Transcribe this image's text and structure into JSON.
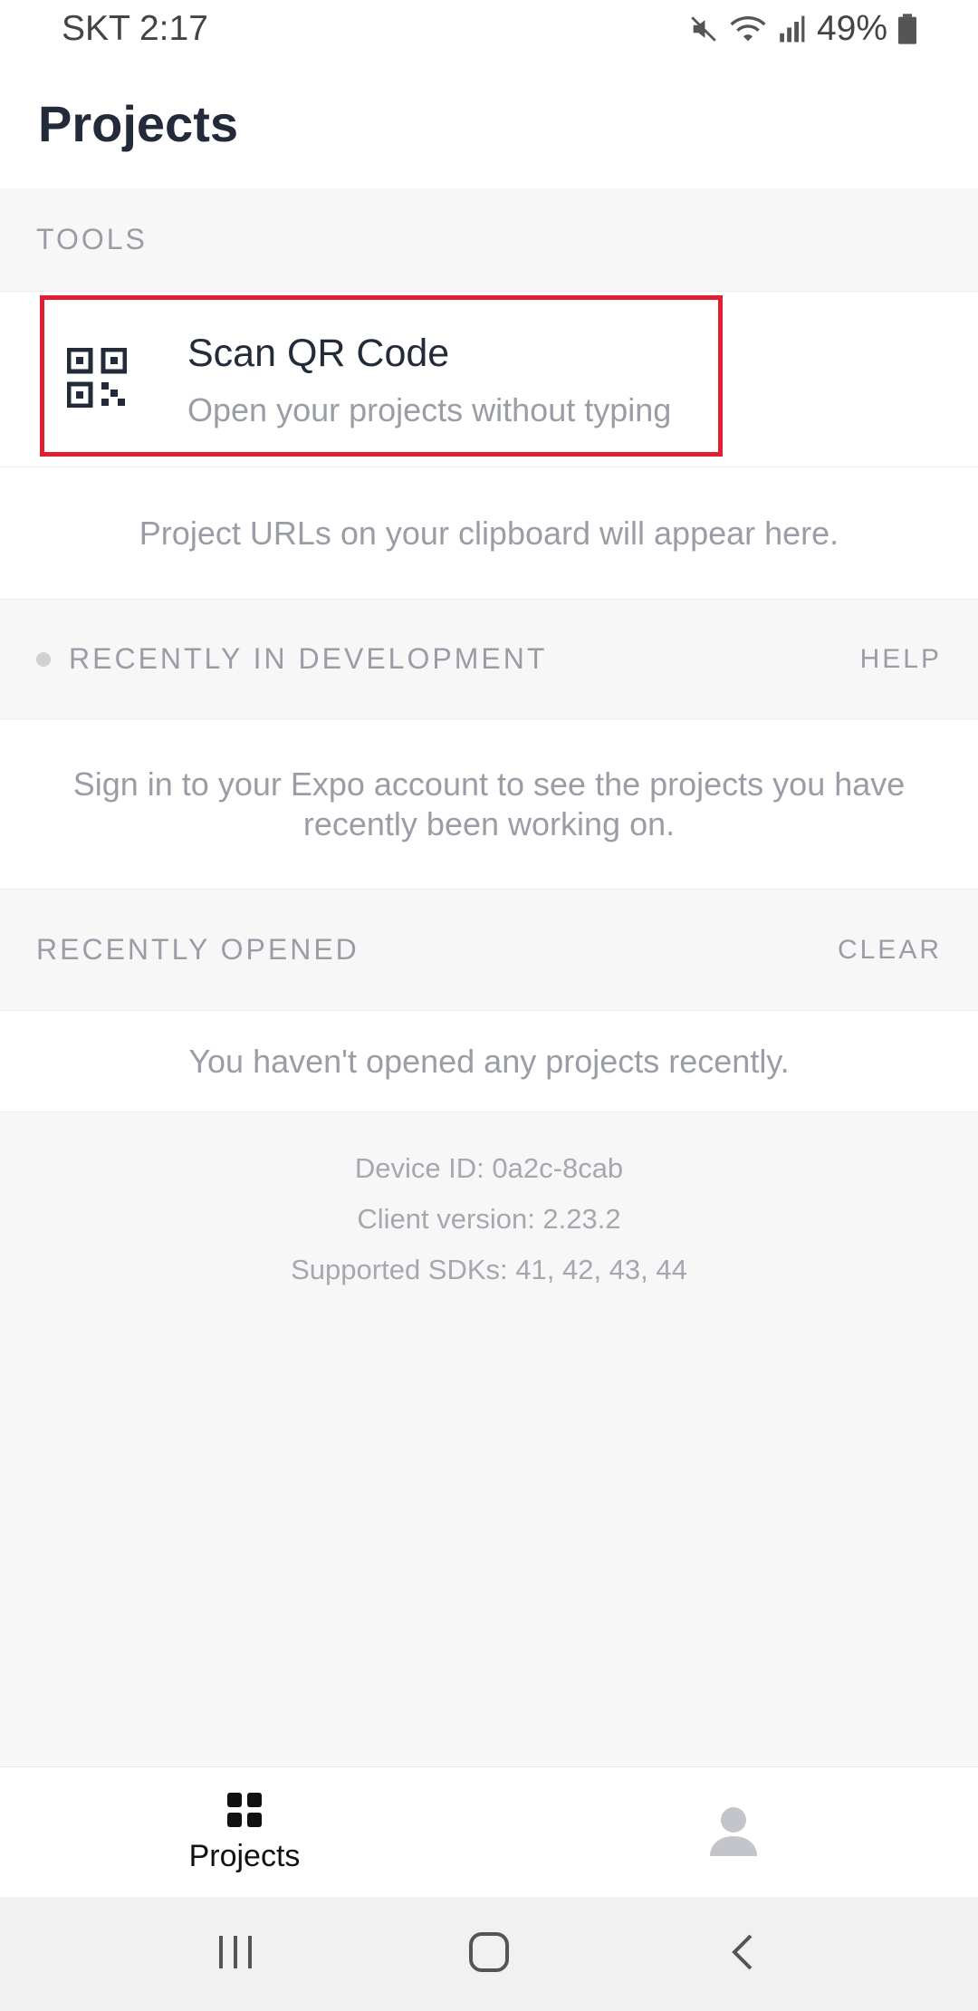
{
  "status_bar": {
    "carrier_time": "SKT 2:17",
    "battery_percent": "49%",
    "icons": [
      "mute-icon",
      "wifi-icon",
      "signal-icon",
      "battery-icon"
    ]
  },
  "header": {
    "title": "Projects"
  },
  "tools": {
    "section_label": "TOOLS",
    "scan": {
      "title": "Scan QR Code",
      "subtitle": "Open your projects without typing",
      "icon": "qr-code-icon"
    },
    "clipboard_note": "Project URLs on your clipboard will appear here."
  },
  "recent_dev": {
    "section_label": "RECENTLY IN DEVELOPMENT",
    "action": "HELP",
    "message": "Sign in to your Expo account to see the projects you have recently been working on."
  },
  "recent_opened": {
    "section_label": "RECENTLY OPENED",
    "action": "CLEAR",
    "message": "You haven't opened any projects recently."
  },
  "device": {
    "device_id": "Device ID: 0a2c-8cab",
    "client_version": "Client version: 2.23.2",
    "supported_sdks": "Supported SDKs: 41, 42, 43, 44"
  },
  "bottom_nav": {
    "tabs": [
      {
        "label": "Projects",
        "icon": "grid-icon",
        "active": true
      },
      {
        "label": "",
        "icon": "profile-icon",
        "active": false
      }
    ]
  },
  "system_nav": {
    "buttons": [
      "recents-icon",
      "home-icon",
      "back-icon"
    ]
  },
  "colors": {
    "highlight": "#e0202e",
    "muted_text": "#9a9da6",
    "title_text": "#232b3a"
  }
}
